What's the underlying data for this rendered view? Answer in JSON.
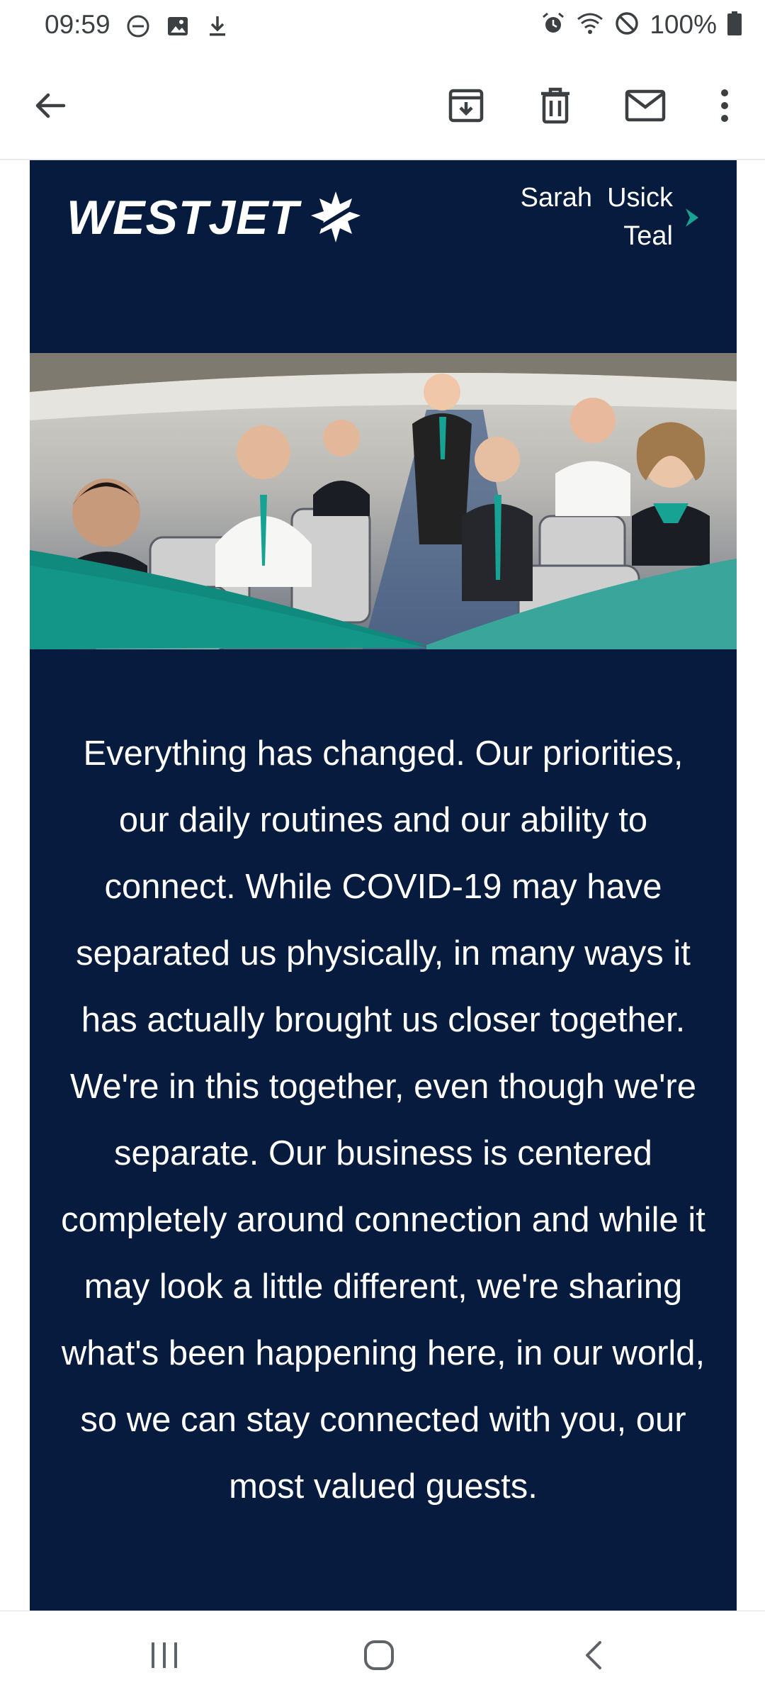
{
  "status_bar": {
    "time": "09:59",
    "battery": "100%",
    "icons_left": [
      "do-not-disturb-icon",
      "image-icon",
      "download-icon"
    ],
    "icons_right": [
      "alarm-icon",
      "wifi-icon",
      "blocked-icon",
      "battery-icon"
    ]
  },
  "toolbar": {
    "icons": [
      "back-arrow-icon",
      "archive-icon",
      "delete-icon",
      "mark-unread-icon",
      "more-options-icon"
    ]
  },
  "email": {
    "brand": "WESTJET",
    "recipient_name": "Sarah  Usick",
    "recipient_tier": "Teal",
    "body": "Everything has changed. Our priorities, our daily routines and our ability to connect. While COVID-19 may have separated us physically, in many ways it has actually brought us closer together. We're in this together, even though we're separate. Our business is centered completely around connection and while it may look a little different, we're sharing what's been happening here, in our world, so we can stay connected with you, our most valued guests."
  },
  "colors": {
    "email_bg": "#061b3d",
    "accent_teal": "#17a394",
    "text_light": "#ffffff"
  },
  "nav_bar": {
    "icons": [
      "recent-apps-icon",
      "home-icon",
      "back-icon"
    ]
  }
}
